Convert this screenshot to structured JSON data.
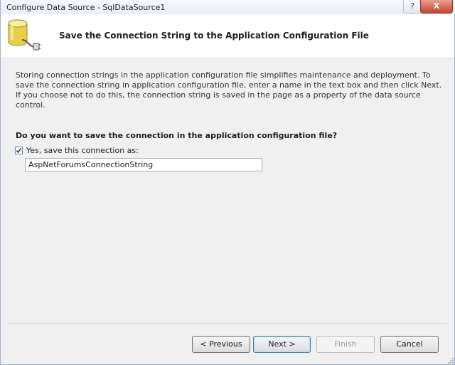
{
  "window": {
    "title": "Configure Data Source - SqlDataSource1",
    "help_label": "?",
    "close_label": "X"
  },
  "header": {
    "title": "Save the Connection String to the Application Configuration File",
    "icon": "database-plug-icon"
  },
  "content": {
    "description": "Storing connection strings in the application configuration file simplifies maintenance and deployment. To save the connection string in application configuration file, enter a name in the text box and then click Next. If you choose not to do this, the connection string is saved in the page as a property of the data source control.",
    "question": "Do you want to save the connection in the application configuration file?",
    "checkbox_label": "Yes, save this connection as:",
    "checkbox_checked": true,
    "connection_name": "AspNetForumsConnectionString"
  },
  "buttons": {
    "previous": "< Previous",
    "next": "Next >",
    "finish": "Finish",
    "cancel": "Cancel"
  },
  "colors": {
    "accent": "#3c7fb1",
    "header_bg": "#ffffff",
    "dialog_bg": "#f0f0f0"
  }
}
